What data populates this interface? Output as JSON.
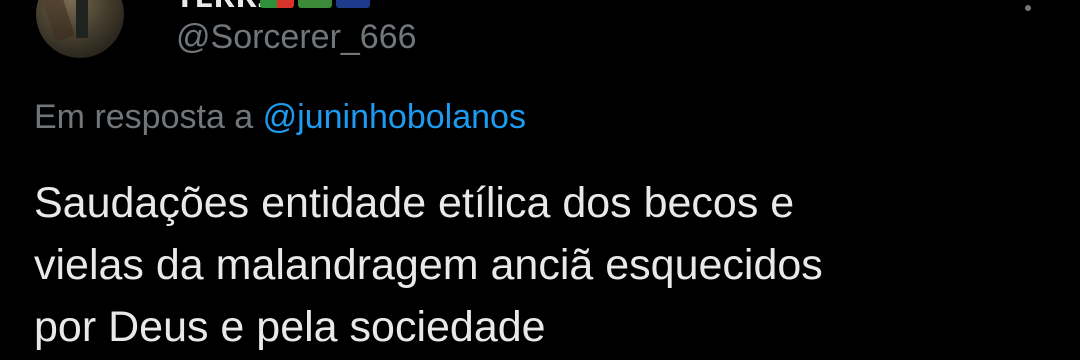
{
  "author": {
    "display_name": "ᴛᴇʀʀɪ ",
    "username": "@Sorcerer_666",
    "avatar_icon": "avatar-photo"
  },
  "reply": {
    "prefix": "Em resposta a",
    "mention": "@juninhobolanos"
  },
  "tweet": {
    "lines": [
      "Saudações entidade etílica dos becos e",
      "vielas da malandragem anciã esquecidos",
      "por Deus e pela sociedade"
    ]
  },
  "colors": {
    "background": "#000000",
    "text": "#e7e9ea",
    "muted": "#71767b",
    "link": "#1d9bf0"
  },
  "icons": {
    "more": "more-vertical-icon"
  }
}
